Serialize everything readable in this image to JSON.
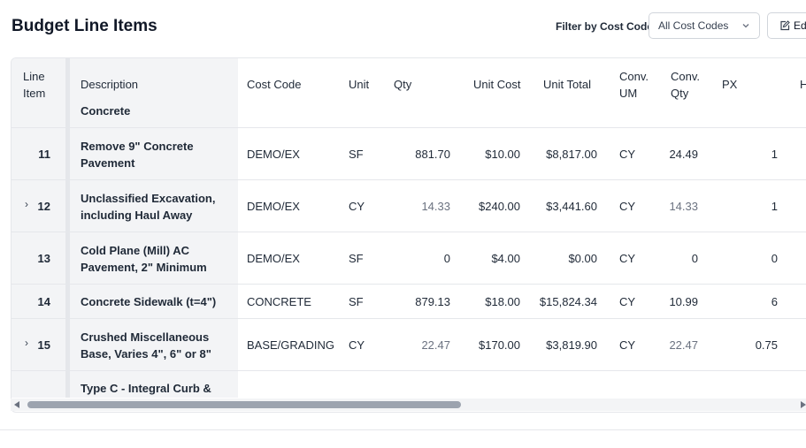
{
  "page": {
    "title": "Budget Line Items",
    "filter_label": "Filter by Cost Code:",
    "filter_value": "All Cost Codes",
    "edit_label": "Ed"
  },
  "columns": {
    "line_item": [
      "Line",
      "Item"
    ],
    "description": "Description",
    "cost_code": "Cost Code",
    "unit": "Unit",
    "qty": "Qty",
    "unit_cost": "Unit Cost",
    "unit_total": "Unit Total",
    "conv_um": [
      "Conv.",
      "UM"
    ],
    "conv_qty": [
      "Conv.",
      "Qty"
    ],
    "px": "PX",
    "next_partial": "H"
  },
  "partial_top_row": {
    "description": "Concrete"
  },
  "rows": [
    {
      "line": "11",
      "expandable": false,
      "description": [
        "Remove 9\" Concrete",
        "Pavement"
      ],
      "cost_code": "DEMO/EX",
      "unit": "SF",
      "qty": "881.70",
      "qty_muted": false,
      "unit_cost": "$10.00",
      "unit_total": "$8,817.00",
      "conv_um": "CY",
      "conv_qty": "24.49",
      "conv_qty_muted": false,
      "px": "1"
    },
    {
      "line": "12",
      "expandable": true,
      "description": [
        "Unclassified Excavation,",
        "including Haul Away"
      ],
      "cost_code": "DEMO/EX",
      "unit": "CY",
      "qty": "14.33",
      "qty_muted": true,
      "unit_cost": "$240.00",
      "unit_total": "$3,441.60",
      "conv_um": "CY",
      "conv_qty": "14.33",
      "conv_qty_muted": true,
      "px": "1"
    },
    {
      "line": "13",
      "expandable": false,
      "description": [
        "Cold Plane (Mill) AC",
        "Pavement, 2\" Minimum"
      ],
      "cost_code": "DEMO/EX",
      "unit": "SF",
      "qty": "0",
      "qty_muted": false,
      "unit_cost": "$4.00",
      "unit_total": "$0.00",
      "conv_um": "CY",
      "conv_qty": "0",
      "conv_qty_muted": false,
      "px": "0"
    },
    {
      "line": "14",
      "expandable": false,
      "description": [
        "Concrete Sidewalk (t=4\")"
      ],
      "cost_code": "CONCRETE",
      "unit": "SF",
      "qty": "879.13",
      "qty_muted": false,
      "unit_cost": "$18.00",
      "unit_total": "$15,824.34",
      "conv_um": "CY",
      "conv_qty": "10.99",
      "conv_qty_muted": false,
      "px": "6"
    },
    {
      "line": "15",
      "expandable": true,
      "description": [
        "Crushed Miscellaneous",
        "Base, Varies 4\", 6\" or 8\""
      ],
      "cost_code": "BASE/GRADING",
      "unit": "CY",
      "qty": "22.47",
      "qty_muted": true,
      "unit_cost": "$170.00",
      "unit_total": "$3,819.90",
      "conv_um": "CY",
      "conv_qty": "22.47",
      "conv_qty_muted": true,
      "px": "0.75"
    }
  ],
  "partial_bottom_row": {
    "description": "Type C - Integral Curb &"
  },
  "icons": {
    "chevron": "chevron-down-icon",
    "edit": "edit-icon",
    "expand": "chevron-right-icon"
  }
}
